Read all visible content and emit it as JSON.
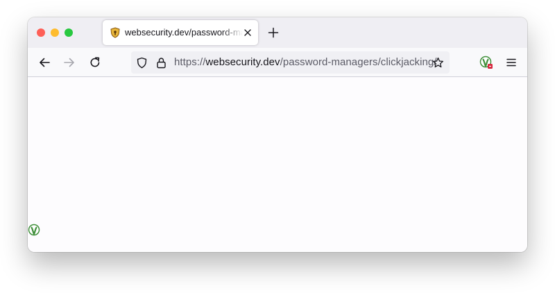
{
  "tab": {
    "title": "websecurity.dev/password-managers/clickjacking/"
  },
  "urlbar": {
    "scheme": "https://",
    "host": "websecurity.dev",
    "path": "/password-managers/clickjacking/"
  },
  "icons": {
    "favicon": "shield-favicon-icon",
    "tab_close": "close-icon",
    "new_tab": "plus-icon",
    "back": "arrow-left-icon",
    "forward": "arrow-right-icon",
    "reload": "reload-icon",
    "tracking_protection": "shield-icon",
    "lock": "lock-icon",
    "bookmark": "star-icon",
    "extension": "password-manager-extension-icon",
    "menu": "hamburger-menu-icon",
    "page_logo": "password-manager-logo-icon"
  },
  "colors": {
    "close_light": "#fe5f57",
    "minimize_light": "#febc2e",
    "zoom_light": "#28c840",
    "tabstrip": "#efeef3",
    "toolbar": "#f9f9fb",
    "urlbar": "#f0f0f4",
    "content": "#fdfcfe",
    "extension_green": "#3f8f3a",
    "extension_badge": "#d7263d"
  }
}
